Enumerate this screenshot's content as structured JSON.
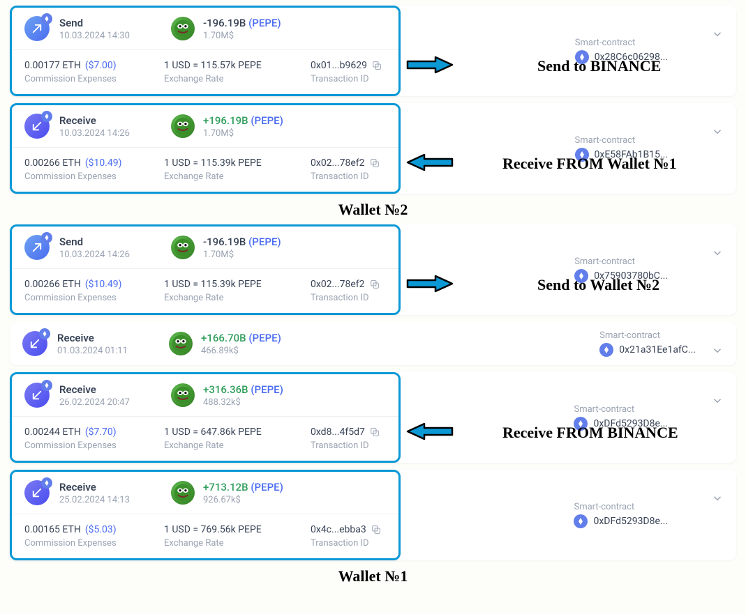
{
  "sections": {
    "wallet2_label": "Wallet №2",
    "wallet1_label": "Wallet №1"
  },
  "labels": {
    "commission": "Commission Expenses",
    "rate": "Exchange Rate",
    "txid": "Transaction ID",
    "smart_contract": "Smart-contract"
  },
  "tx": [
    {
      "dir": "send",
      "highlight": true,
      "title": "Send",
      "date": "10.03.2024 14:30",
      "amount": "-196.19B",
      "amt_class": "neg",
      "ticker": "(PEPE)",
      "usd": "1.70M$",
      "sc": "0x28C6c06298...",
      "expand": true,
      "details": {
        "commission": "0.00177 ETH",
        "commission_usd": "($7.00)",
        "rate": "1 USD = 115.57k PEPE",
        "txid": "0x01...b9629"
      },
      "arrow_dir": "right",
      "annot": "Send to BINANCE"
    },
    {
      "dir": "receive",
      "highlight": true,
      "title": "Receive",
      "date": "10.03.2024 14:26",
      "amount": "+196.19B",
      "amt_class": "pos",
      "ticker": "(PEPE)",
      "usd": "1.70M$",
      "sc": "0xE58FAb1B15...",
      "expand": true,
      "details": {
        "commission": "0.00266 ETH",
        "commission_usd": "($10.49)",
        "rate": "1 USD = 115.39k PEPE",
        "txid": "0x02...78ef2"
      },
      "arrow_dir": "left",
      "annot": "Receive FROM Wallet №1"
    },
    {
      "dir": "send",
      "highlight": true,
      "title": "Send",
      "date": "10.03.2024 14:26",
      "amount": "-196.19B",
      "amt_class": "neg",
      "ticker": "(PEPE)",
      "usd": "1.70M$",
      "sc": "0x75903780bC...",
      "expand": true,
      "details": {
        "commission": "0.00266 ETH",
        "commission_usd": "($10.49)",
        "rate": "1 USD = 115.39k PEPE",
        "txid": "0x02...78ef2"
      },
      "arrow_dir": "right",
      "annot": "Send to Wallet №2"
    },
    {
      "dir": "receive",
      "highlight": false,
      "title": "Receive",
      "date": "01.03.2024 01:11",
      "amount": "+166.70B",
      "amt_class": "pos",
      "ticker": "(PEPE)",
      "usd": "466.89k$",
      "sc": "0x21a31Ee1afC...",
      "expand": true,
      "details": null,
      "arrow_dir": null,
      "annot": null
    },
    {
      "dir": "receive",
      "highlight": true,
      "title": "Receive",
      "date": "26.02.2024 20:47",
      "amount": "+316.36B",
      "amt_class": "pos",
      "ticker": "(PEPE)",
      "usd": "488.32k$",
      "sc": "0xDFd5293D8e...",
      "expand": true,
      "details": {
        "commission": "0.00244 ETH",
        "commission_usd": "($7.70)",
        "rate": "1 USD = 647.86k PEPE",
        "txid": "0xd8...4f5d7"
      },
      "arrow_dir": "left",
      "annot": "Receive FROM BINANCE"
    },
    {
      "dir": "receive",
      "highlight": true,
      "title": "Receive",
      "date": "25.02.2024 14:13",
      "amount": "+713.12B",
      "amt_class": "pos",
      "ticker": "(PEPE)",
      "usd": "926.67k$",
      "sc": "0xDFd5293D8e...",
      "expand": true,
      "details": {
        "commission": "0.00165 ETH",
        "commission_usd": "($5.03)",
        "rate": "1 USD = 769.56k PEPE",
        "txid": "0x4c...ebba3"
      },
      "arrow_dir": null,
      "annot": null
    }
  ]
}
